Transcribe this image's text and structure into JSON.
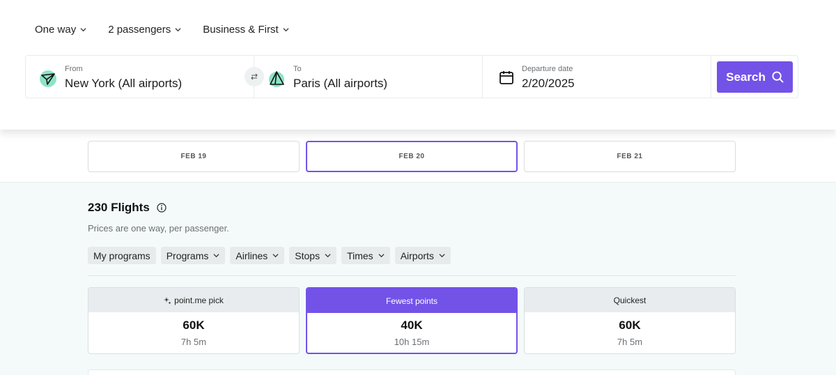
{
  "options": {
    "trip_type": "One way",
    "passengers": "2 passengers",
    "cabin": "Business & First"
  },
  "search": {
    "from_label": "From",
    "from_value": "New York (All airports)",
    "to_label": "To",
    "to_value": "Paris (All airports)",
    "date_label": "Departure date",
    "date_value": "2/20/2025",
    "button_label": "Search"
  },
  "dates": [
    {
      "label": "FEB 19",
      "selected": false
    },
    {
      "label": "FEB 20",
      "selected": true
    },
    {
      "label": "FEB 21",
      "selected": false
    }
  ],
  "results": {
    "count": "230 Flights",
    "subtitle": "Prices are one way, per passenger.",
    "filters": [
      "My programs",
      "Programs",
      "Airlines",
      "Stops",
      "Times",
      "Airports"
    ]
  },
  "cards": [
    {
      "header": "point.me pick",
      "points": "60K",
      "duration": "7h 5m",
      "selected": false
    },
    {
      "header": "Fewest points",
      "points": "40K",
      "duration": "10h 15m",
      "selected": true
    },
    {
      "header": "Quickest",
      "points": "60K",
      "duration": "7h 5m",
      "selected": false
    }
  ],
  "colors": {
    "accent": "#7352e8",
    "mint": "#8de3c8",
    "background": "#f4fafa"
  },
  "icons": {
    "from": "plane-takeoff-icon",
    "to": "plane-landing-icon",
    "swap": "swap-arrows-icon",
    "date": "calendar-icon",
    "search": "search-icon",
    "info": "info-icon",
    "pick": "sparkle-icon"
  }
}
